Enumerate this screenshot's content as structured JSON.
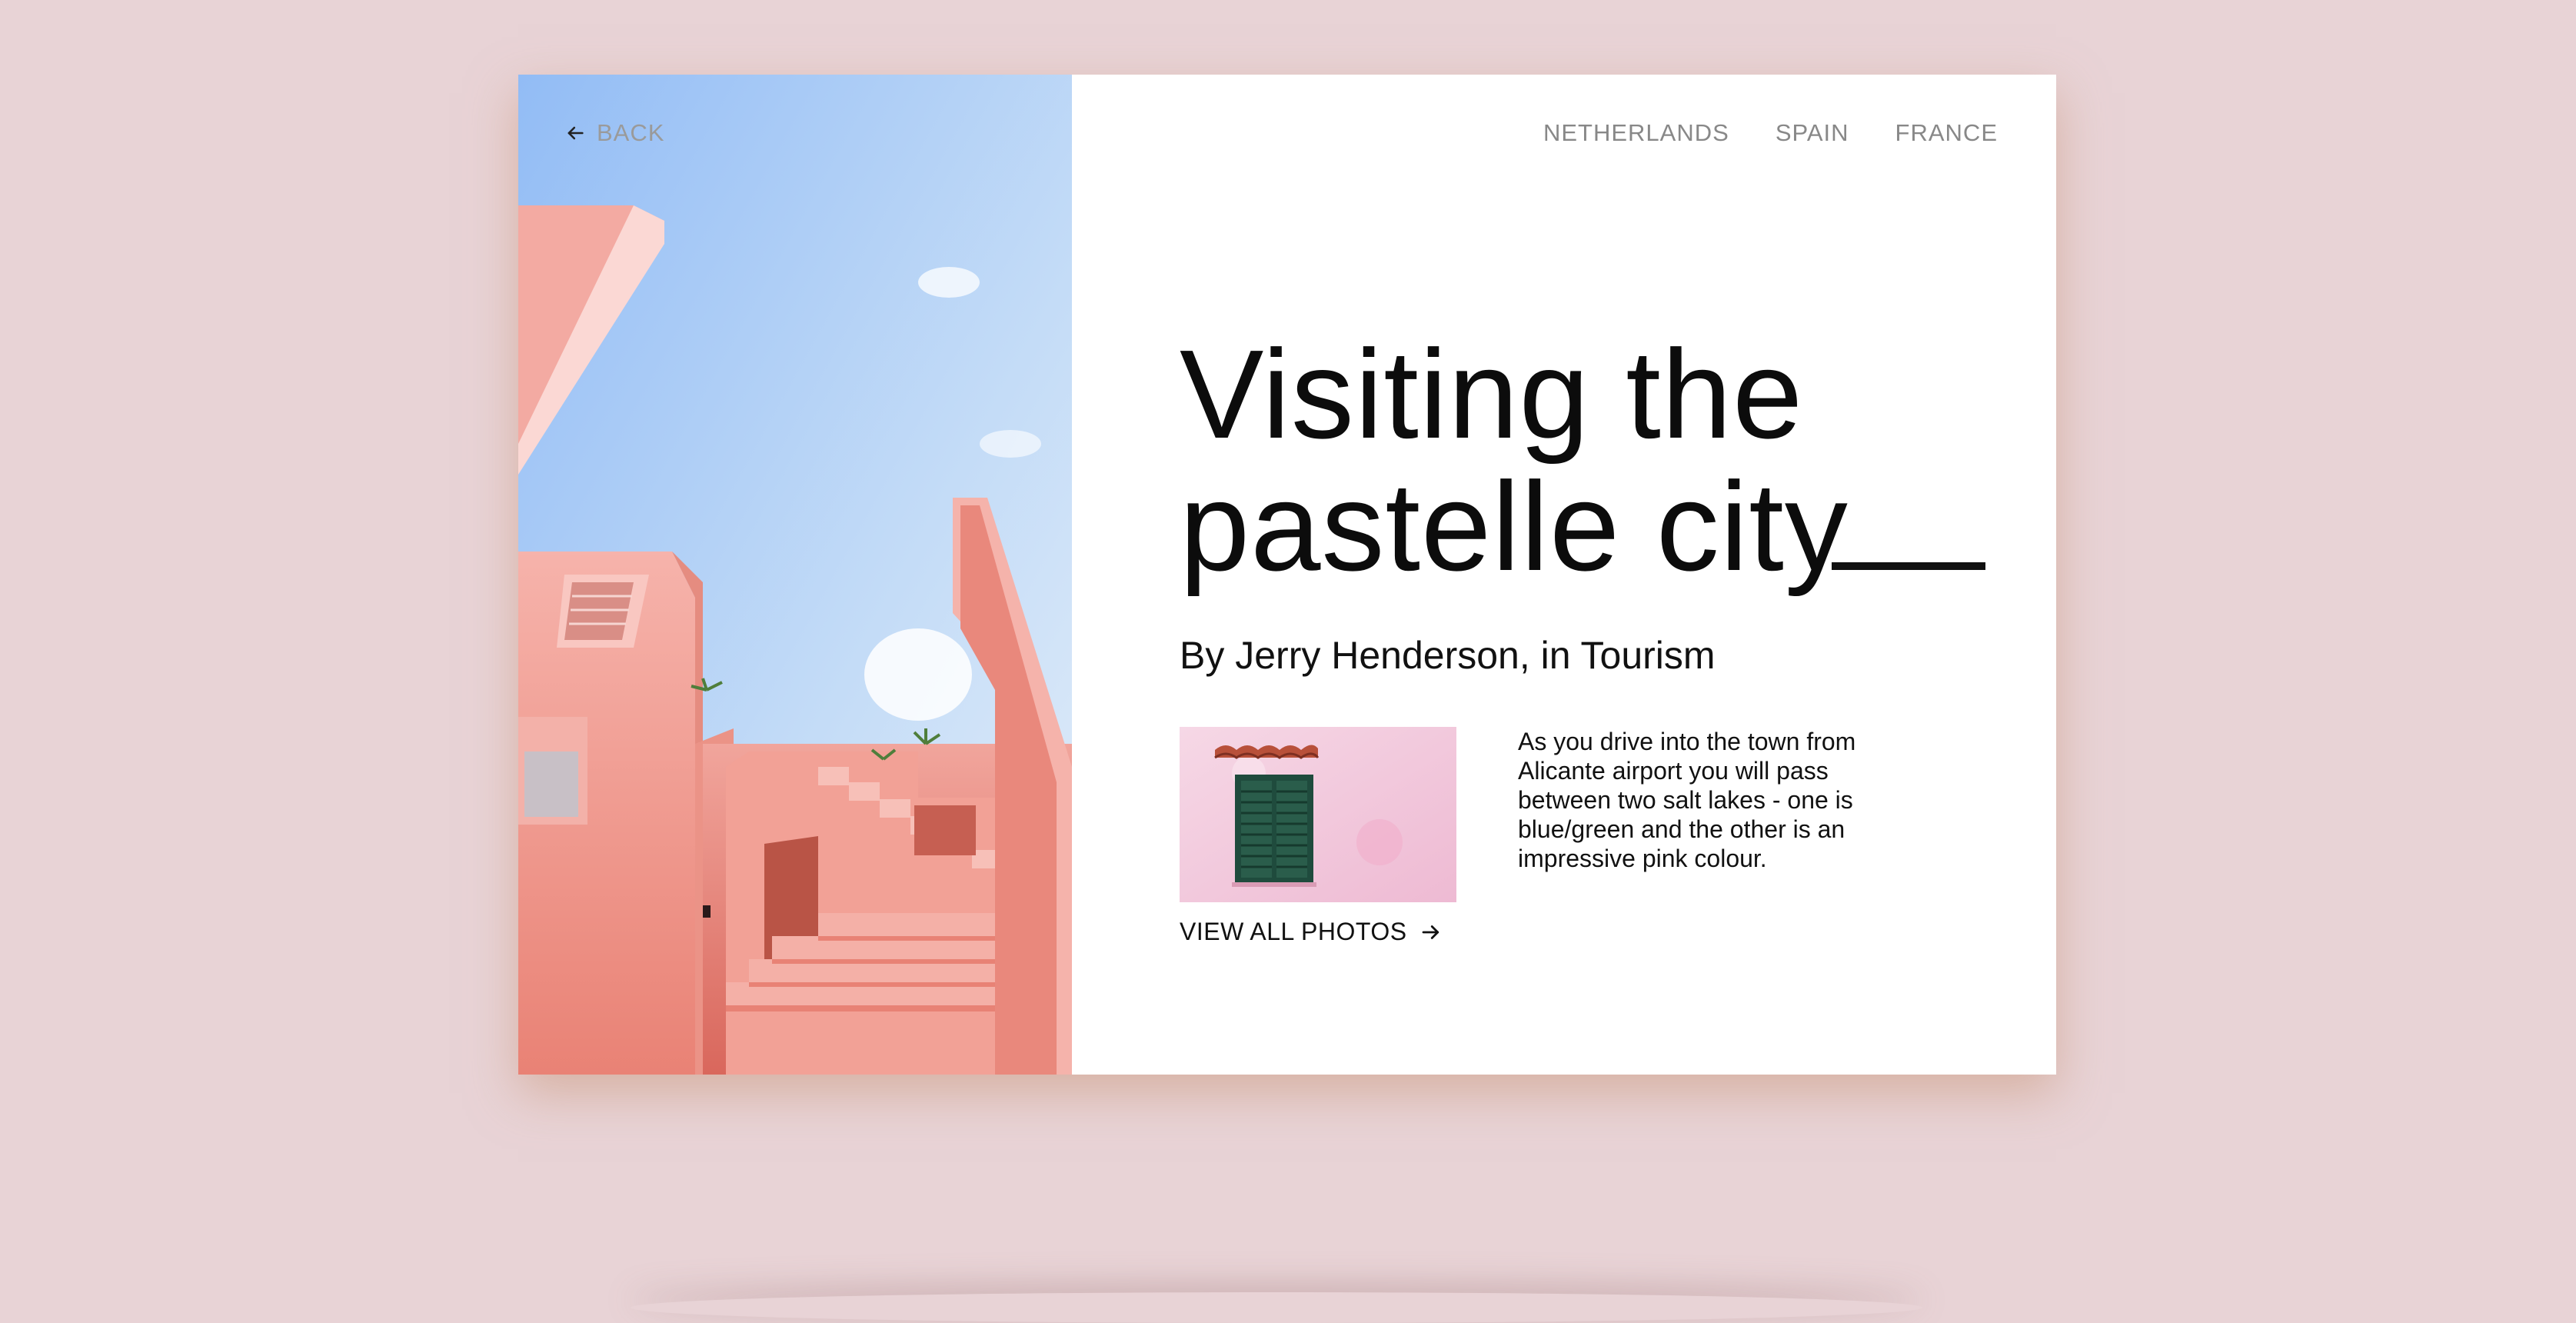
{
  "nav": {
    "back_label": "BACK",
    "links": [
      "NETHERLANDS",
      "SPAIN",
      "FRANCE"
    ]
  },
  "article": {
    "title_line1": "Visiting the",
    "title_line2": "pastelle city",
    "byline": "By Jerry Henderson, in Tourism",
    "excerpt": "As you drive into the town from Alicante airport you will pass between two salt lakes - one is blue/green and the other is an impressive pink colour.",
    "view_all_label": "VIEW ALL PHOTOS"
  },
  "icons": {
    "back": "arrow-left-icon",
    "view_all": "arrow-right-icon"
  },
  "colors": {
    "page_background": "#e8d3d6",
    "card_background": "#ffffff",
    "title_text": "#0c0c0c",
    "nav_text": "#888888",
    "building_pink": "#f2a39b",
    "sky_blue": "#9cc2f4"
  }
}
